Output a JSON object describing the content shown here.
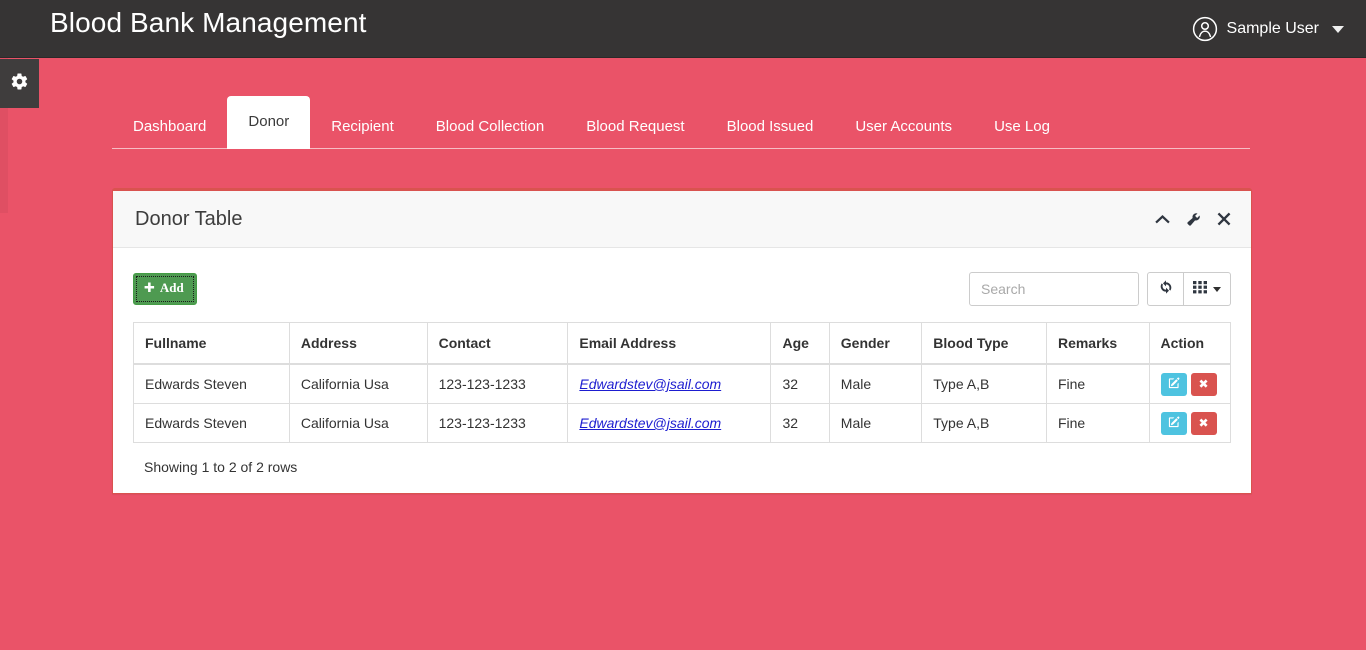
{
  "app": {
    "brand": "Blood Bank Management",
    "background_color": "#ea5368",
    "navbar_color": "#363434"
  },
  "navbar": {
    "user_name": "Sample User",
    "user_icon": "user-circle-icon",
    "caret_icon": "chevron-down-icon"
  },
  "sidebar": {
    "toggle_icon": "gear-icon"
  },
  "tabs": [
    {
      "label": "Dashboard",
      "active": false
    },
    {
      "label": "Donor",
      "active": true
    },
    {
      "label": "Recipient",
      "active": false
    },
    {
      "label": "Blood Collection",
      "active": false
    },
    {
      "label": "Blood Request",
      "active": false
    },
    {
      "label": "Blood Issued",
      "active": false
    },
    {
      "label": "User Accounts",
      "active": false
    },
    {
      "label": "Use Log",
      "active": false
    }
  ],
  "panel": {
    "title": "Donor Table",
    "border_color": "#d9534f",
    "tools": [
      {
        "name": "collapse-icon",
        "glyph": "chevron-up"
      },
      {
        "name": "settings-icon",
        "glyph": "wrench"
      },
      {
        "name": "close-icon",
        "glyph": "times"
      }
    ]
  },
  "toolbar": {
    "add_label": "Add",
    "add_icon": "plus-icon",
    "add_color": "#4e9a51",
    "search_placeholder": "Search",
    "search_value": "",
    "refresh_icon": "refresh-icon",
    "columns_icon": "grid-icon"
  },
  "table": {
    "columns": [
      "Fullname",
      "Address",
      "Contact",
      "Email Address",
      "Age",
      "Gender",
      "Blood Type",
      "Remarks",
      "Action"
    ],
    "rows": [
      {
        "fullname": "Edwards Steven",
        "address": "California Usa",
        "contact": "123-123-1233",
        "email": "Edwardstev@jsail.com",
        "age": "32",
        "gender": "Male",
        "blood_type": "Type A,B",
        "remarks": "Fine"
      },
      {
        "fullname": "Edwards Steven",
        "address": "California Usa",
        "contact": "123-123-1233",
        "email": "Edwardstev@jsail.com",
        "age": "32",
        "gender": "Male",
        "blood_type": "Type A,B",
        "remarks": "Fine"
      }
    ],
    "action_icons": {
      "edit": "edit-pencil-icon",
      "edit_color": "#4ec3e0",
      "delete": "delete-x-icon",
      "delete_color": "#d9534f"
    },
    "footer_text": "Showing 1 to 2 of 2 rows"
  }
}
